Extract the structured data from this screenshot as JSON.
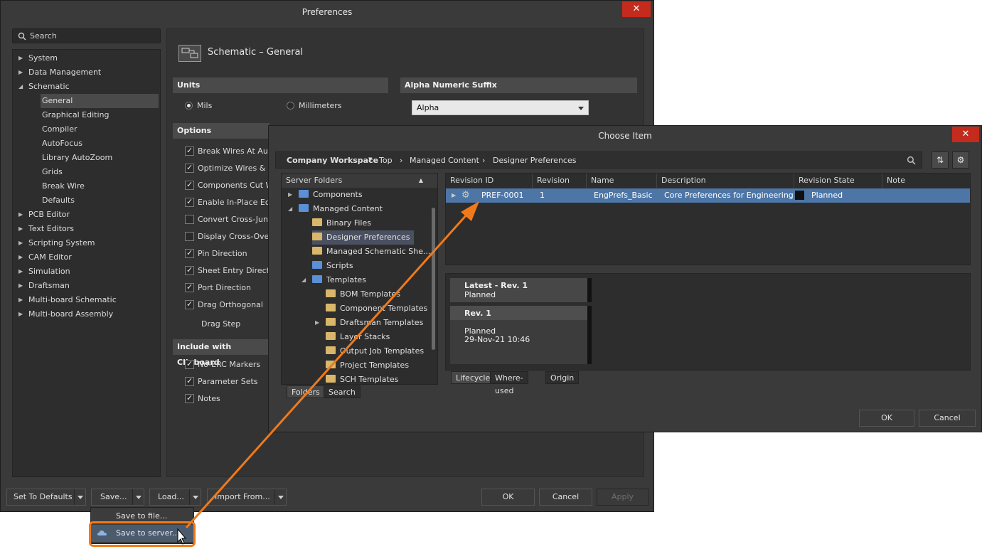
{
  "prefs": {
    "title": "Preferences",
    "close": "✕",
    "search_placeholder": "Search",
    "tree": [
      {
        "label": "System",
        "level": 0,
        "arrow": "▶"
      },
      {
        "label": "Data Management",
        "level": 0,
        "arrow": "▶"
      },
      {
        "label": "Schematic",
        "level": 0,
        "arrow": "◢"
      },
      {
        "label": "General",
        "level": 1,
        "arrow": "",
        "selected": true
      },
      {
        "label": "Graphical Editing",
        "level": 1,
        "arrow": ""
      },
      {
        "label": "Compiler",
        "level": 1,
        "arrow": ""
      },
      {
        "label": "AutoFocus",
        "level": 1,
        "arrow": ""
      },
      {
        "label": "Library AutoZoom",
        "level": 1,
        "arrow": ""
      },
      {
        "label": "Grids",
        "level": 1,
        "arrow": ""
      },
      {
        "label": "Break Wire",
        "level": 1,
        "arrow": ""
      },
      {
        "label": "Defaults",
        "level": 1,
        "arrow": ""
      },
      {
        "label": "PCB Editor",
        "level": 0,
        "arrow": "▶"
      },
      {
        "label": "Text Editors",
        "level": 0,
        "arrow": "▶"
      },
      {
        "label": "Scripting System",
        "level": 0,
        "arrow": "▶"
      },
      {
        "label": "CAM Editor",
        "level": 0,
        "arrow": "▶"
      },
      {
        "label": "Simulation",
        "level": 0,
        "arrow": "▶"
      },
      {
        "label": "Draftsman",
        "level": 0,
        "arrow": "▶"
      },
      {
        "label": "Multi-board Schematic",
        "level": 0,
        "arrow": "▶"
      },
      {
        "label": "Multi-board Assembly",
        "level": 0,
        "arrow": "▶"
      }
    ],
    "page_title": "Schematic – General",
    "units": {
      "header": "Units",
      "mils": "Mils",
      "mm": "Millimeters",
      "selected": "Mils"
    },
    "alpha": {
      "header": "Alpha Numeric Suffix",
      "value": "Alpha"
    },
    "options": {
      "header": "Options",
      "items": [
        {
          "label": "Break Wires At Auto",
          "checked": true
        },
        {
          "label": "Optimize Wires & B",
          "checked": true
        },
        {
          "label": "Components Cut W",
          "checked": true
        },
        {
          "label": "Enable In-Place Edit",
          "checked": true
        },
        {
          "label": "Convert Cross-Junc",
          "checked": false
        },
        {
          "label": "Display Cross-Overs",
          "checked": false
        },
        {
          "label": "Pin Direction",
          "checked": true
        },
        {
          "label": "Sheet Entry Directio",
          "checked": true
        },
        {
          "label": "Port Direction",
          "checked": true
        },
        {
          "label": "Drag Orthogonal",
          "checked": true
        }
      ],
      "drag_step": "Drag Step"
    },
    "clipboard": {
      "header": "Include with Clipboard",
      "items": [
        {
          "label": "No-ERC Markers",
          "checked": true
        },
        {
          "label": "Parameter Sets",
          "checked": true
        },
        {
          "label": "Notes",
          "checked": true
        }
      ]
    },
    "buttons": {
      "defaults": "Set To Defaults",
      "save": "Save...",
      "load": "Load...",
      "import": "Import From...",
      "ok": "OK",
      "cancel": "Cancel",
      "apply": "Apply"
    },
    "save_menu": {
      "to_file": "Save to file...",
      "to_server": "Save to server..."
    }
  },
  "choose": {
    "title": "Choose Item",
    "close": "✕",
    "workspace": "Company Workspace",
    "path": [
      "Top",
      "Managed Content",
      "Designer Preferences"
    ],
    "sep": "›",
    "folders_header": "Server Folders",
    "folders": [
      {
        "label": "Components",
        "indent": 0,
        "tw": "▶",
        "blue": true
      },
      {
        "label": "Managed Content",
        "indent": 0,
        "tw": "◢",
        "blue": true
      },
      {
        "label": "Binary Files",
        "indent": 1,
        "tw": ""
      },
      {
        "label": "Designer Preferences",
        "indent": 1,
        "tw": "",
        "selected": true
      },
      {
        "label": "Managed Schematic She...",
        "indent": 1,
        "tw": ""
      },
      {
        "label": "Scripts",
        "indent": 1,
        "tw": "",
        "blue": true
      },
      {
        "label": "Templates",
        "indent": 1,
        "tw": "◢",
        "blue": true
      },
      {
        "label": "BOM Templates",
        "indent": 2,
        "tw": ""
      },
      {
        "label": "Component Templates",
        "indent": 2,
        "tw": ""
      },
      {
        "label": "Draftsman Templates",
        "indent": 2,
        "tw": "▶"
      },
      {
        "label": "Layer Stacks",
        "indent": 2,
        "tw": ""
      },
      {
        "label": "Output Job Templates",
        "indent": 2,
        "tw": ""
      },
      {
        "label": "Project Templates",
        "indent": 2,
        "tw": ""
      },
      {
        "label": "SCH Templates",
        "indent": 2,
        "tw": ""
      }
    ],
    "left_tabs": [
      "Folders",
      "Search"
    ],
    "columns": [
      "Revision ID",
      "Revision",
      "Name",
      "Description",
      "Revision State",
      "Note"
    ],
    "row": {
      "id": "PREF-0001",
      "revision": "1",
      "name": "EngPrefs_Basic",
      "description": "Core Preferences for Engineering",
      "state": "Planned"
    },
    "lifecycle": {
      "latest_title": "Latest - Rev.  1",
      "latest_state": "Planned",
      "rev_title": "Rev. 1",
      "rev_state": "Planned",
      "rev_date": "29-Nov-21 10:46"
    },
    "bottom_tabs": [
      "Lifecycle",
      "Where-used",
      "Origin"
    ],
    "ok": "OK",
    "cancel": "Cancel"
  }
}
